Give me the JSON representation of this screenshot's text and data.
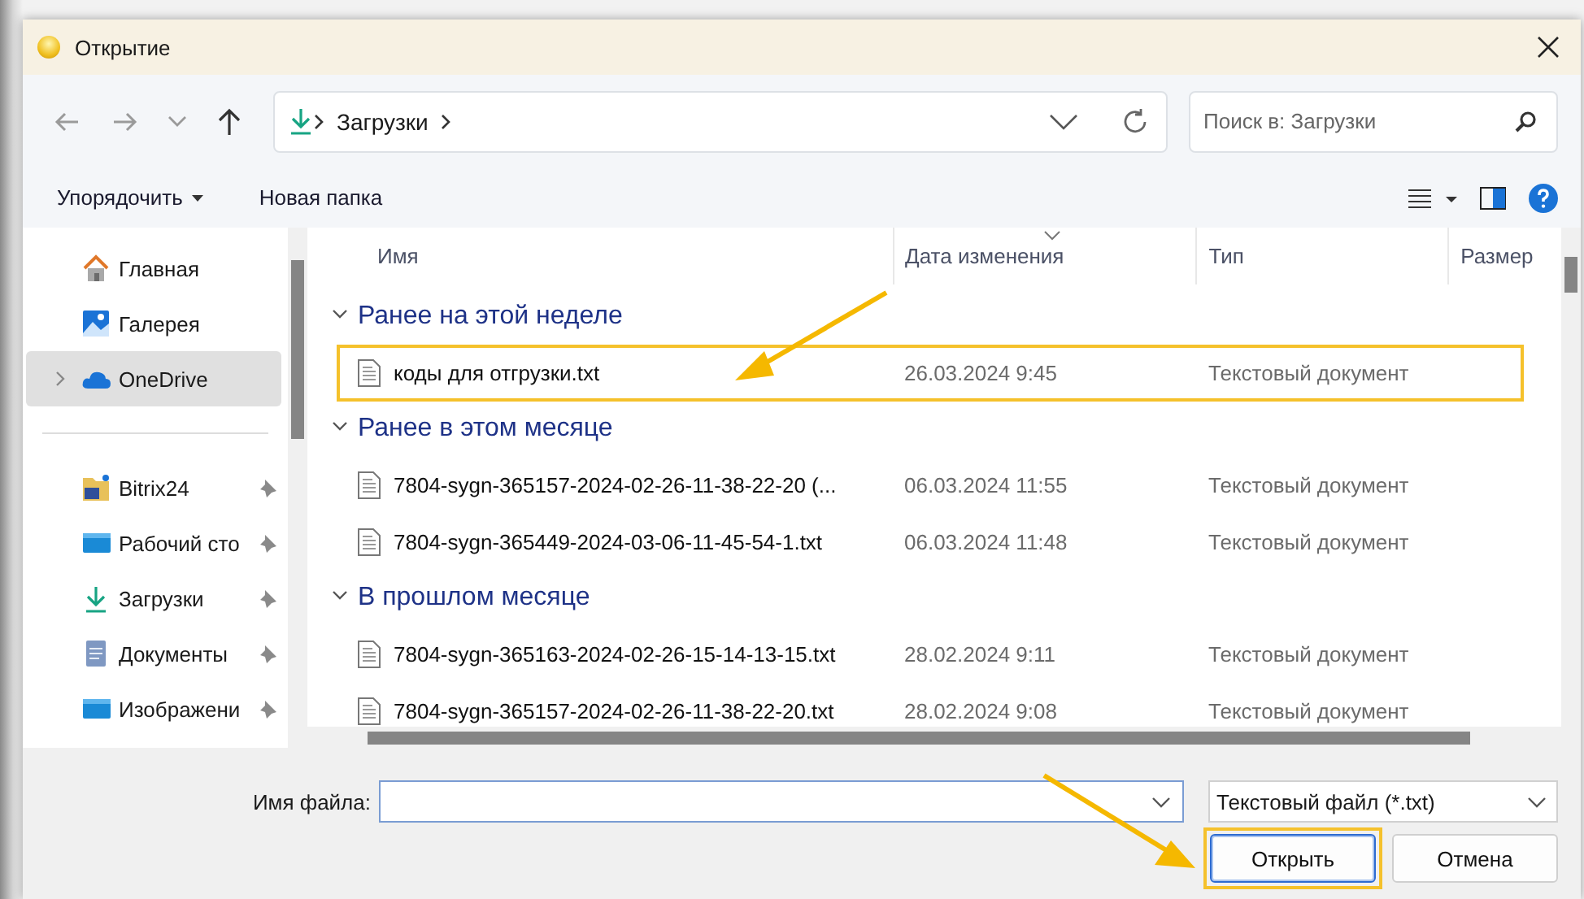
{
  "window": {
    "title": "Открытие"
  },
  "address": {
    "segments": [
      "Загрузки"
    ]
  },
  "search": {
    "placeholder": "Поиск в: Загрузки"
  },
  "toolbar": {
    "items": [
      {
        "label": "Упорядочить",
        "menu": true
      },
      {
        "label": "Новая папка",
        "menu": false
      }
    ]
  },
  "sidebar": {
    "groups": [
      {
        "items": [
          {
            "label": "Главная",
            "kind": "home",
            "selected": false,
            "expandable": false,
            "pinned": false
          },
          {
            "label": "Галерея",
            "kind": "gallery",
            "selected": false,
            "expandable": false,
            "pinned": false
          },
          {
            "label": "OneDrive",
            "kind": "cloud",
            "selected": true,
            "expandable": true,
            "pinned": false
          }
        ]
      },
      {
        "items": [
          {
            "label": "Bitrix24",
            "kind": "folder",
            "selected": false,
            "expandable": false,
            "pinned": true
          },
          {
            "label": "Рабочий сто",
            "kind": "desktop",
            "selected": false,
            "expandable": false,
            "pinned": true
          },
          {
            "label": "Загрузки",
            "kind": "download",
            "selected": false,
            "expandable": false,
            "pinned": true
          },
          {
            "label": "Документы",
            "kind": "document",
            "selected": false,
            "expandable": false,
            "pinned": true
          },
          {
            "label": "Изображени",
            "kind": "desktop",
            "selected": false,
            "expandable": false,
            "pinned": true
          }
        ]
      }
    ]
  },
  "columns": [
    {
      "label": "Имя",
      "sorted": false
    },
    {
      "label": "Дата изменения",
      "sorted": true
    },
    {
      "label": "Тип",
      "sorted": false
    },
    {
      "label": "Размер",
      "sorted": false
    }
  ],
  "groups": [
    {
      "title": "Ранее на этой неделе",
      "expanded": true,
      "files": [
        {
          "name": "коды для отгрузки.txt",
          "date": "26.03.2024 9:45",
          "type": "Текстовый документ",
          "highlighted": true
        }
      ]
    },
    {
      "title": "Ранее в этом месяце",
      "expanded": true,
      "files": [
        {
          "name": "7804-sygn-365157-2024-02-26-11-38-22-20 (...",
          "date": "06.03.2024 11:55",
          "type": "Текстовый документ",
          "highlighted": false
        },
        {
          "name": "7804-sygn-365449-2024-03-06-11-45-54-1.txt",
          "date": "06.03.2024 11:48",
          "type": "Текстовый документ",
          "highlighted": false
        }
      ]
    },
    {
      "title": "В прошлом месяце",
      "expanded": true,
      "files": [
        {
          "name": "7804-sygn-365163-2024-02-26-15-14-13-15.txt",
          "date": "28.02.2024 9:11",
          "type": "Текстовый документ",
          "highlighted": false
        },
        {
          "name": "7804-sygn-365157-2024-02-26-11-38-22-20.txt",
          "date": "28.02.2024 9:08",
          "type": "Текстовый документ",
          "highlighted": false
        }
      ]
    }
  ],
  "file_name": {
    "label": "Имя файла:"
  },
  "file_type": {
    "value": "Текстовый файл (*.txt)"
  },
  "buttons": [
    {
      "label": "Открыть",
      "default": true,
      "highlighted": true
    },
    {
      "label": "Отмена",
      "default": false,
      "highlighted": false
    }
  ]
}
